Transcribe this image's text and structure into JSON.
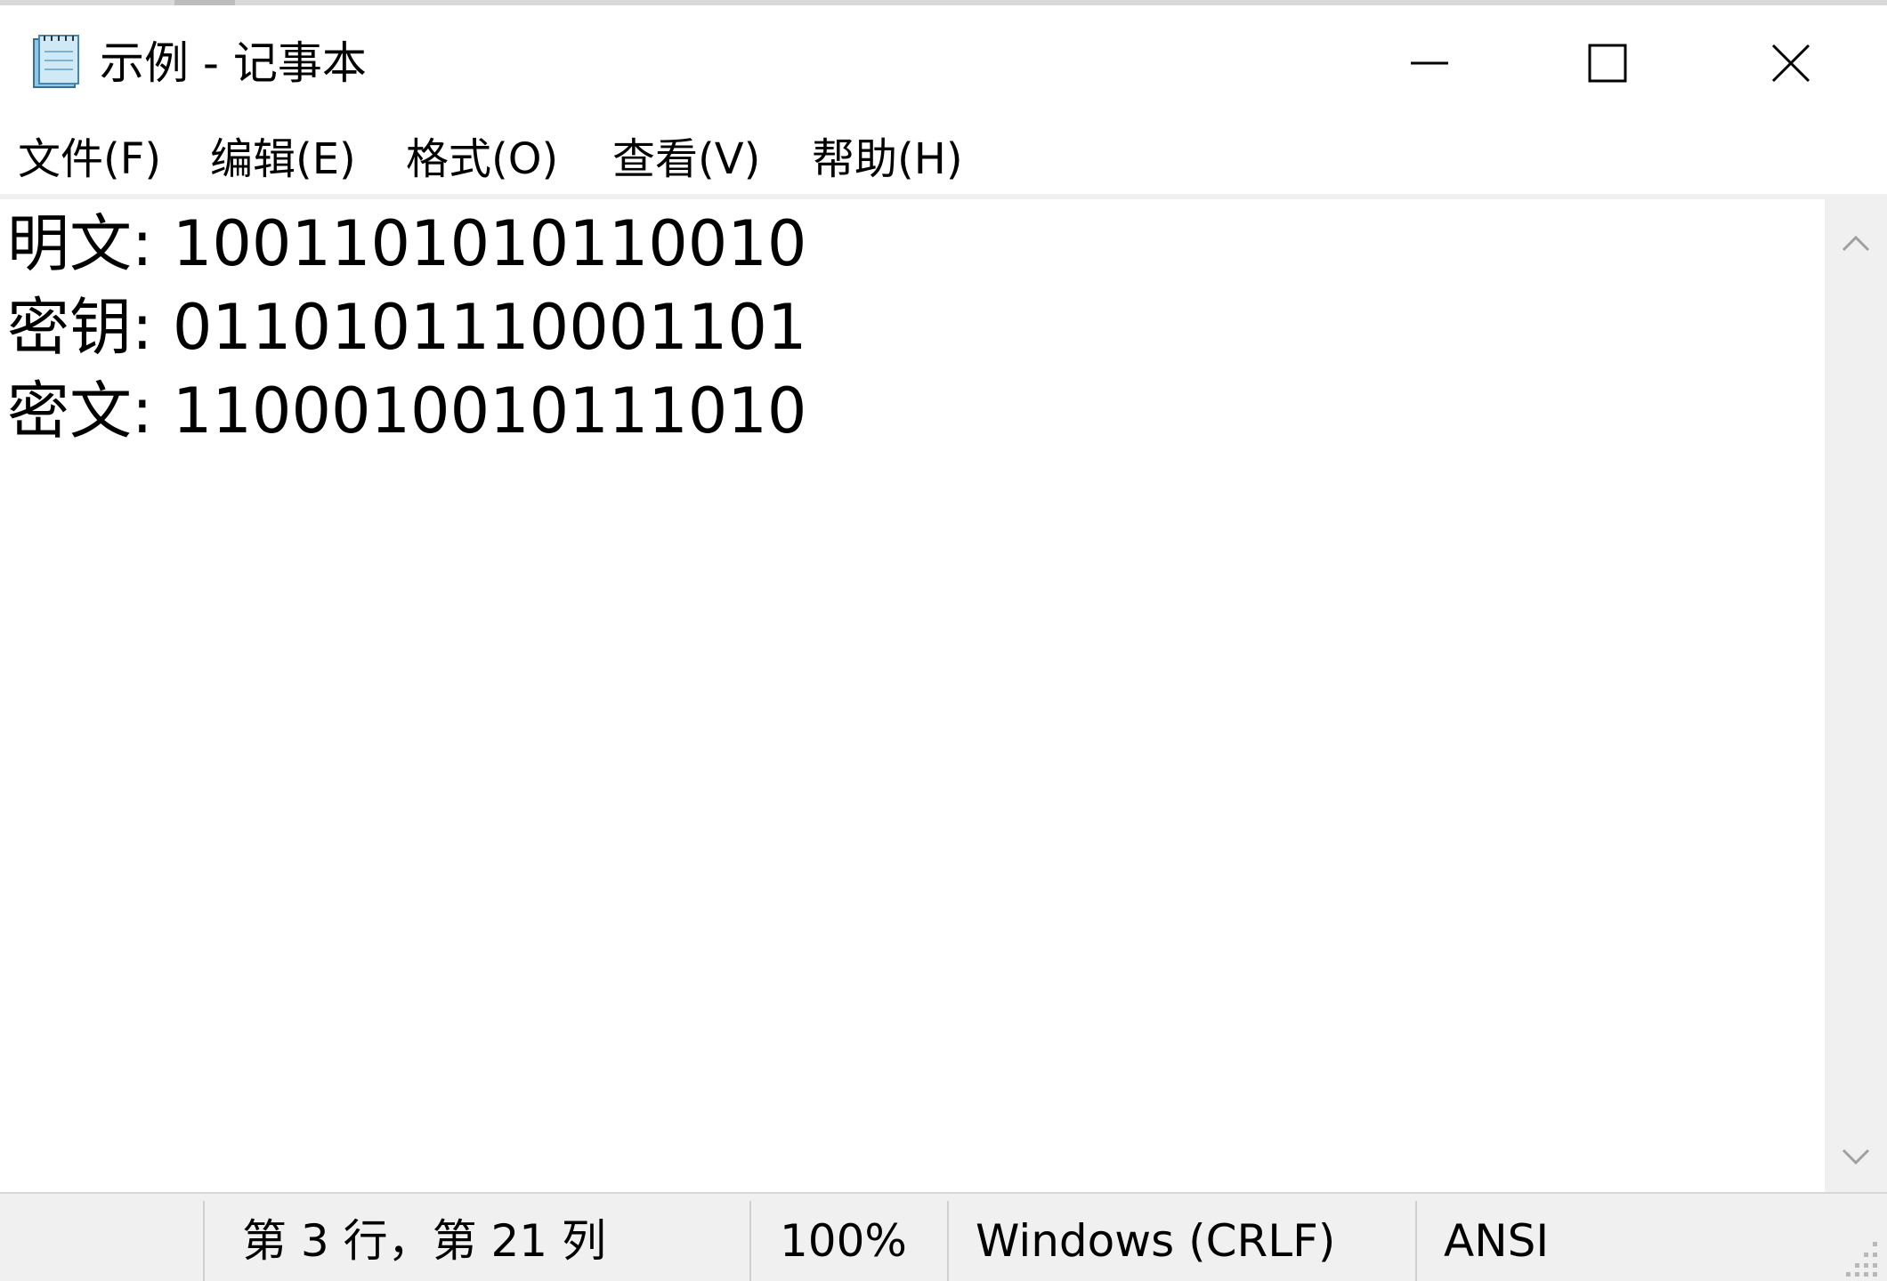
{
  "window": {
    "title": "示例 - 记事本",
    "icon": "notepad-icon",
    "controls": {
      "minimize": "minimize-icon",
      "maximize": "maximize-icon",
      "close": "close-icon"
    }
  },
  "menu": {
    "items": [
      {
        "label": "文件(F)"
      },
      {
        "label": "编辑(E)"
      },
      {
        "label": "格式(O)"
      },
      {
        "label": "查看(V)"
      },
      {
        "label": "帮助(H)"
      }
    ]
  },
  "editor": {
    "lines": [
      "明文: 1001101010110010",
      "密钥: 0110101110001101",
      "密文: 1100010010111010"
    ]
  },
  "scrollbar": {
    "up_icon": "chevron-up-icon",
    "down_icon": "chevron-down-icon"
  },
  "status": {
    "position": "第 3 行，第 21 列",
    "zoom": "100%",
    "line_ending": "Windows (CRLF)",
    "encoding": "ANSI"
  },
  "colors": {
    "background": "#ffffff",
    "chrome": "#f0f0f0",
    "text": "#000000"
  }
}
